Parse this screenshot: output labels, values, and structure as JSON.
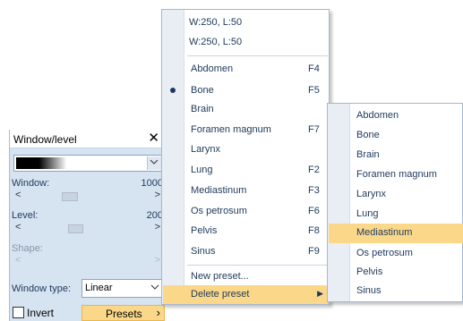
{
  "panel": {
    "title": "Window/level",
    "close_glyph": "✕",
    "lut_dropdown_glyph": "⌄",
    "window_label": "Window:",
    "window_value": "1000",
    "level_label": "Level:",
    "level_value": "200",
    "shape_label": "Shape:",
    "window_type_label": "Window type:",
    "window_type_value": "Linear",
    "window_type_chevron": "⌄",
    "invert_label": "Invert",
    "invert_checked": false,
    "presets_label": "Presets",
    "presets_chevron": "›",
    "scroll_left": "<",
    "scroll_right": ">",
    "accent_color": "#fbd889"
  },
  "menu": {
    "recent": [
      "W:250, L:50",
      "W:250, L:50"
    ],
    "presets": [
      {
        "label": "Abdomen",
        "shortcut": "F4"
      },
      {
        "label": "Bone",
        "shortcut": "F5",
        "selected": true
      },
      {
        "label": "Brain",
        "shortcut": ""
      },
      {
        "label": "Foramen magnum",
        "shortcut": "F7"
      },
      {
        "label": "Larynx",
        "shortcut": ""
      },
      {
        "label": "Lung",
        "shortcut": "F2"
      },
      {
        "label": "Mediastinum",
        "shortcut": "F3"
      },
      {
        "label": "Os petrosum",
        "shortcut": "F6"
      },
      {
        "label": "Pelvis",
        "shortcut": "F8"
      },
      {
        "label": "Sinus",
        "shortcut": "F9"
      }
    ],
    "new_preset": "New preset...",
    "delete_preset": "Delete preset",
    "submenu_arrow": "▶"
  },
  "submenu": {
    "items": [
      "Abdomen",
      "Bone",
      "Brain",
      "Foramen magnum",
      "Larynx",
      "Lung",
      "Mediastinum",
      "Os petrosum",
      "Pelvis",
      "Sinus"
    ],
    "highlighted": "Mediastinum"
  }
}
